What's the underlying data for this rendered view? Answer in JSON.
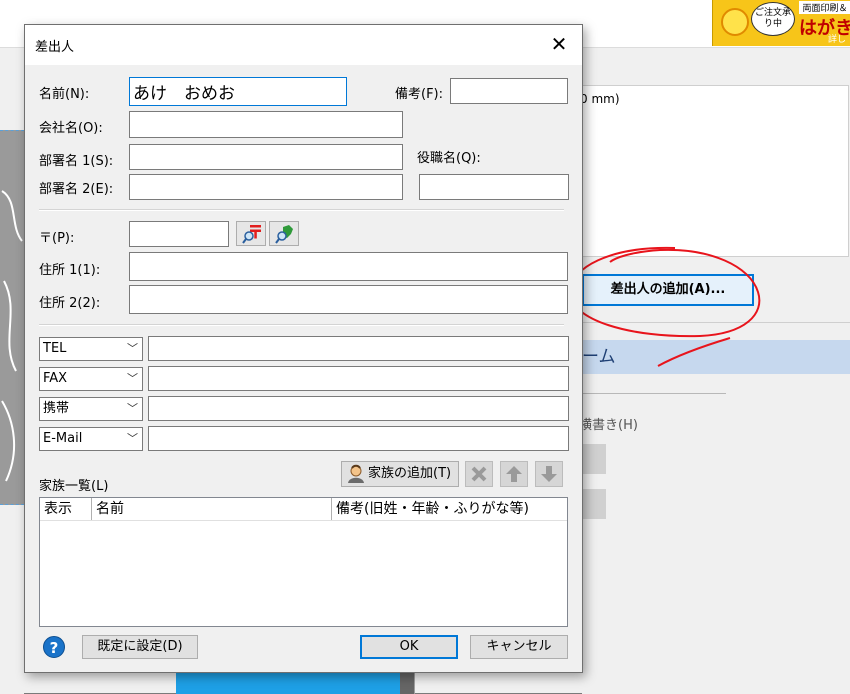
{
  "background": {
    "ad": {
      "bubble_text": "ご注文承り中",
      "top_text": "両面印刷＆",
      "main_text": "はがき",
      "sub_text": "詳し"
    },
    "info_text": "0 mm)",
    "add_sender_button": "差出人の追加(A)...",
    "section_header": "ーム",
    "vertical_option": "横書き(H)"
  },
  "dialog": {
    "title": "差出人",
    "name_label": "名前(N):",
    "name_value": "あけ　おめお",
    "remarks_label": "備考(F):",
    "remarks_value": "",
    "company_label": "会社名(O):",
    "company_value": "",
    "dept1_label": "部署名 1(S):",
    "dept1_value": "",
    "title_label": "役職名(Q):",
    "title_value": "",
    "dept2_label": "部署名 2(E):",
    "dept2_value": "",
    "postal_label": "〒(P):",
    "postal_value": "",
    "address1_label": "住所 1(1):",
    "address1_value": "",
    "address2_label": "住所 2(2):",
    "address2_value": "",
    "contacts": [
      {
        "type": "TEL",
        "value": ""
      },
      {
        "type": "FAX",
        "value": ""
      },
      {
        "type": "携帯",
        "value": ""
      },
      {
        "type": "E-Mail",
        "value": ""
      }
    ],
    "family_label": "家族一覧(L)",
    "add_family_button": "家族の追加(T)",
    "family_columns": [
      "表示",
      "名前",
      "備考(旧姓・年齢・ふりがな等)"
    ],
    "family_rows": [],
    "set_default_button": "既定に設定(D)",
    "ok_button": "OK",
    "cancel_button": "キャンセル"
  },
  "colors": {
    "accent": "#0078d7",
    "annotation": "#e8141c",
    "section": "#c6d8ee"
  }
}
